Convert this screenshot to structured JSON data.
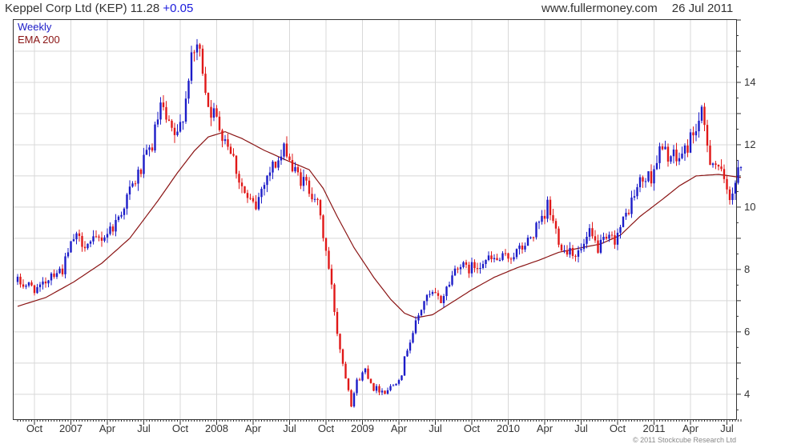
{
  "header": {
    "title": "Keppel Corp Ltd (KEP)",
    "price": "11.28",
    "change": "+0.05",
    "site": "www.fullermoney.com",
    "date": "26 Jul 2011"
  },
  "credit": "© 2011 Stockcube Research Ltd",
  "colors": {
    "up": "#1c1cc8",
    "down": "#e01818",
    "ema": "#8a1414",
    "grid": "#d8d8d8",
    "axis": "#333333"
  },
  "chart_data": {
    "type": "candlestick",
    "legend": [
      "Weekly",
      "EMA 200"
    ],
    "frequency": "Weekly",
    "ylim": [
      3.2,
      16.0
    ],
    "y_ticks": [
      4,
      6,
      8,
      10,
      12,
      14
    ],
    "x_ticks": [
      "Oct",
      "2007",
      "Apr",
      "Jul",
      "Oct",
      "2008",
      "Apr",
      "Jul",
      "Oct",
      "2009",
      "Apr",
      "Jul",
      "Oct",
      "2010",
      "Apr",
      "Jul",
      "Oct",
      "2011",
      "Apr",
      "Jul"
    ],
    "x_tick_weeks": [
      6,
      19,
      32,
      45,
      58,
      71,
      84,
      97,
      110,
      123,
      136,
      149,
      162,
      175,
      188,
      201,
      214,
      227,
      240,
      253
    ],
    "legend_position": "top-left",
    "grid": true,
    "close_path": [
      [
        0,
        7.6
      ],
      [
        8,
        7.35
      ],
      [
        12,
        7.9
      ],
      [
        16,
        8.0
      ],
      [
        20,
        9.0
      ],
      [
        26,
        8.8
      ],
      [
        31,
        9.1
      ],
      [
        35,
        9.5
      ],
      [
        40,
        10.5
      ],
      [
        44,
        11.2
      ],
      [
        48,
        12.0
      ],
      [
        51,
        13.2
      ],
      [
        54,
        12.5
      ],
      [
        57,
        12.2
      ],
      [
        60,
        13.5
      ],
      [
        61,
        14.3
      ],
      [
        64,
        15.2
      ],
      [
        66,
        14.5
      ],
      [
        68,
        13.3
      ],
      [
        72,
        12.6
      ],
      [
        76,
        11.9
      ],
      [
        79,
        10.9
      ],
      [
        82,
        10.2
      ],
      [
        85,
        10.0
      ],
      [
        88,
        10.9
      ],
      [
        91,
        11.3
      ],
      [
        94,
        11.6
      ],
      [
        96,
        11.9
      ],
      [
        98,
        11.2
      ],
      [
        101,
        10.9
      ],
      [
        104,
        10.6
      ],
      [
        106,
        10.4
      ],
      [
        108,
        9.6
      ],
      [
        110,
        8.6
      ],
      [
        112,
        7.4
      ],
      [
        114,
        6.0
      ],
      [
        116,
        5.0
      ],
      [
        118,
        4.2
      ],
      [
        119,
        3.7
      ],
      [
        121,
        4.4
      ],
      [
        124,
        4.8
      ],
      [
        127,
        4.2
      ],
      [
        131,
        4.1
      ],
      [
        134,
        4.3
      ],
      [
        137,
        4.7
      ],
      [
        139,
        5.5
      ],
      [
        141,
        6.0
      ],
      [
        143,
        6.5
      ],
      [
        145,
        7.0
      ],
      [
        148,
        7.2
      ],
      [
        151,
        7.0
      ],
      [
        154,
        7.6
      ],
      [
        157,
        8.2
      ],
      [
        160,
        8.0
      ],
      [
        163,
        8.1
      ],
      [
        166,
        8.3
      ],
      [
        169,
        8.3
      ],
      [
        172,
        8.3
      ],
      [
        175,
        8.4
      ],
      [
        179,
        8.6
      ],
      [
        182,
        8.9
      ],
      [
        185,
        9.3
      ],
      [
        188,
        9.6
      ],
      [
        189,
        10.1
      ],
      [
        191,
        9.5
      ],
      [
        193,
        9.0
      ],
      [
        195,
        8.6
      ],
      [
        197,
        8.7
      ],
      [
        199,
        8.5
      ],
      [
        201,
        8.6
      ],
      [
        204,
        9.1
      ],
      [
        207,
        8.7
      ],
      [
        210,
        8.9
      ],
      [
        213,
        9.0
      ],
      [
        216,
        9.5
      ],
      [
        219,
        10.2
      ],
      [
        222,
        10.8
      ],
      [
        226,
        11.0
      ],
      [
        229,
        11.8
      ],
      [
        232,
        11.7
      ],
      [
        235,
        11.5
      ],
      [
        238,
        11.8
      ],
      [
        241,
        12.4
      ],
      [
        244,
        12.9
      ],
      [
        245,
        12.5
      ],
      [
        247,
        11.6
      ],
      [
        250,
        11.3
      ],
      [
        252,
        10.7
      ],
      [
        254,
        10.4
      ],
      [
        256,
        10.8
      ],
      [
        258,
        11.28
      ]
    ],
    "ema200_path": [
      [
        0,
        6.82
      ],
      [
        10,
        7.1
      ],
      [
        20,
        7.6
      ],
      [
        30,
        8.2
      ],
      [
        40,
        9.0
      ],
      [
        50,
        10.2
      ],
      [
        57,
        11.1
      ],
      [
        63,
        11.8
      ],
      [
        68,
        12.25
      ],
      [
        74,
        12.42
      ],
      [
        80,
        12.2
      ],
      [
        88,
        11.82
      ],
      [
        96,
        11.5
      ],
      [
        104,
        11.2
      ],
      [
        109,
        10.6
      ],
      [
        114,
        9.7
      ],
      [
        120,
        8.7
      ],
      [
        127,
        7.75
      ],
      [
        133,
        7.05
      ],
      [
        138,
        6.6
      ],
      [
        142,
        6.45
      ],
      [
        148,
        6.55
      ],
      [
        155,
        6.95
      ],
      [
        162,
        7.35
      ],
      [
        170,
        7.75
      ],
      [
        178,
        8.05
      ],
      [
        186,
        8.3
      ],
      [
        193,
        8.55
      ],
      [
        200,
        8.68
      ],
      [
        208,
        8.82
      ],
      [
        215,
        9.1
      ],
      [
        222,
        9.7
      ],
      [
        230,
        10.25
      ],
      [
        236,
        10.68
      ],
      [
        242,
        11.0
      ],
      [
        250,
        11.05
      ],
      [
        258,
        10.95
      ]
    ]
  }
}
